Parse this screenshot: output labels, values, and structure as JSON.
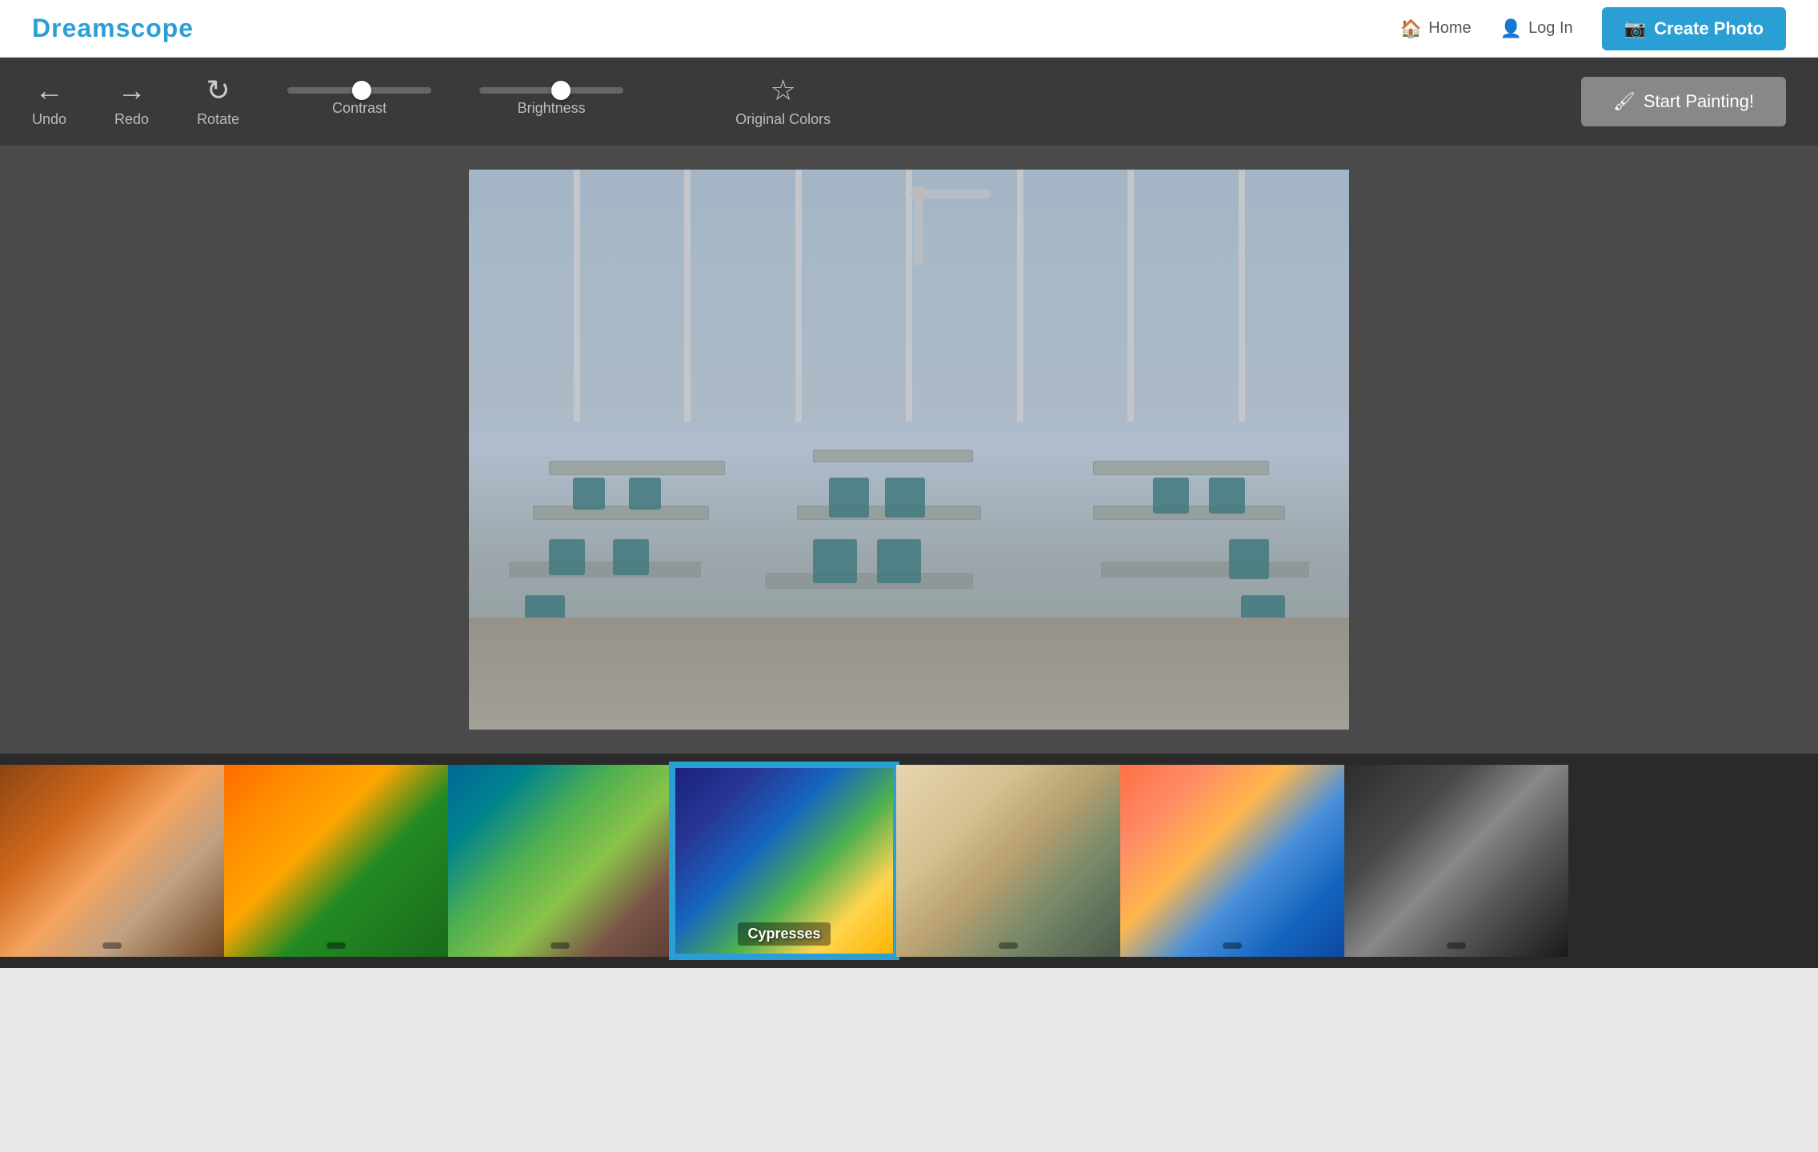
{
  "header": {
    "logo": "Dreamscope",
    "nav": {
      "home_label": "Home",
      "login_label": "Log In",
      "create_photo_label": "Create Photo"
    }
  },
  "toolbar": {
    "undo_label": "Undo",
    "redo_label": "Redo",
    "rotate_label": "Rotate",
    "contrast_label": "Contrast",
    "brightness_label": "Brightness",
    "original_colors_label": "Original Colors",
    "start_painting_label": "Start Painting!"
  },
  "styles": [
    {
      "id": "portrait",
      "label": "",
      "css_class": "style-portrait",
      "active": false
    },
    {
      "id": "autumn",
      "label": "",
      "css_class": "style-autumn",
      "active": false
    },
    {
      "id": "abstract",
      "label": "",
      "css_class": "style-abstract",
      "active": false
    },
    {
      "id": "starry",
      "label": "Cypresses",
      "css_class": "style-starry",
      "active": true
    },
    {
      "id": "boats",
      "label": "",
      "css_class": "style-boats",
      "active": false
    },
    {
      "id": "impressionist",
      "label": "",
      "css_class": "style-impressionist",
      "active": false
    },
    {
      "id": "man",
      "label": "",
      "css_class": "style-man",
      "active": false
    }
  ]
}
